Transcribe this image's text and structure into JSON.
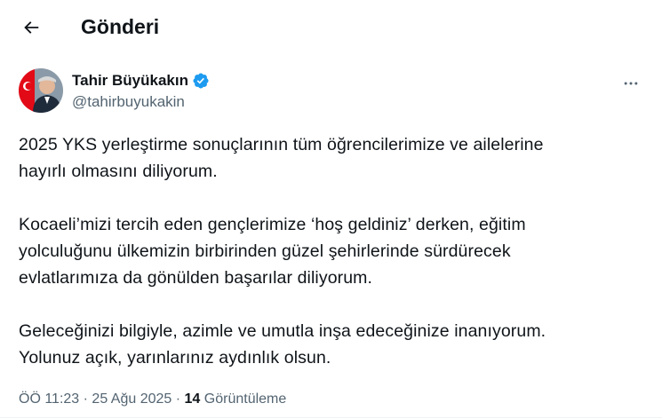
{
  "header": {
    "title": "Gönderi",
    "back_icon": "arrow-left-icon"
  },
  "author": {
    "name": "Tahir Büyükakın",
    "handle": "@tahirbuyukakin",
    "verified": true,
    "verified_color": "#1d9bf0"
  },
  "tweet": {
    "paragraphs": [
      [
        "2025 YKS yerleştirme sonuçlarının tüm öğrencilerimize ve ailelerine",
        "hayırlı olmasını diliyorum."
      ],
      [
        "Kocaeli’mizi tercih eden gençlerimize ‘hoş geldiniz’ derken, eğitim",
        "yolculuğunu ülkemizin birbirinden güzel şehirlerinde sürdürecek",
        "evlatlarımıza da gönülden başarılar diliyorum."
      ],
      [
        "Geleceğinizi bilgiyle, azimle ve umutla inşa edeceğinize inanıyorum.",
        "Yolunuz açık, yarınlarınız aydınlık olsun."
      ]
    ]
  },
  "meta": {
    "time": "ÖÖ 11:23",
    "separator": "·",
    "date": "25 Ağu 2025",
    "views_count": "14",
    "views_label": "Görüntüleme"
  },
  "colors": {
    "text": "#0f1419",
    "secondary": "#536471",
    "accent": "#1d9bf0"
  }
}
